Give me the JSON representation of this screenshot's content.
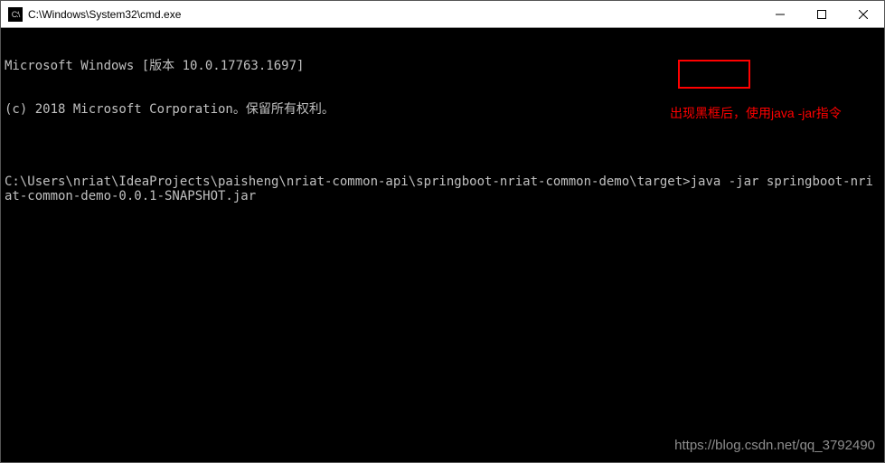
{
  "titlebar": {
    "icon_label": "C:\\",
    "title": "C:\\Windows\\System32\\cmd.exe"
  },
  "terminal": {
    "line1": "Microsoft Windows [版本 10.0.17763.1697]",
    "line2": "(c) 2018 Microsoft Corporation。保留所有权利。",
    "blank": "",
    "prompt_path": "C:\\Users\\nriat\\IdeaProjects\\paisheng\\nriat-common-api\\springboot-nriat-common-demo\\target>",
    "command": "java -jar ",
    "jar_arg": "springboot-nriat-common-demo-0.0.1-SNAPSHOT.jar"
  },
  "annotation": {
    "text": "出现黑框后，使用java -jar指令"
  },
  "watermark": {
    "text": "https://blog.csdn.net/qq_3792490"
  }
}
